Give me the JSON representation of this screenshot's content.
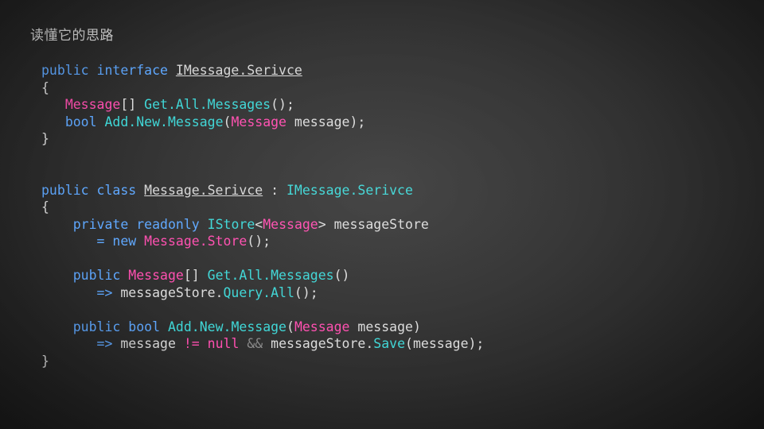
{
  "slide": {
    "title": "读懂它的思路",
    "background_color": "#2d2d2d",
    "code_lines": [
      {
        "id": "line-1",
        "tokens": [
          {
            "t": "public",
            "c": "kw"
          },
          {
            "t": " ",
            "c": "plain"
          },
          {
            "t": "interface",
            "c": "kw"
          },
          {
            "t": " ",
            "c": "plain"
          },
          {
            "t": "IMessage.Serivce",
            "c": "typeund"
          }
        ]
      },
      {
        "id": "line-2",
        "tokens": [
          {
            "t": "{",
            "c": "punct"
          }
        ]
      },
      {
        "id": "line-3",
        "tokens": [
          {
            "t": "   ",
            "c": "plain"
          },
          {
            "t": "Message",
            "c": "typepink"
          },
          {
            "t": "[] ",
            "c": "punct"
          },
          {
            "t": "Get.All.Messages",
            "c": "method"
          },
          {
            "t": "();",
            "c": "punct"
          }
        ]
      },
      {
        "id": "line-4",
        "tokens": [
          {
            "t": "   ",
            "c": "plain"
          },
          {
            "t": "bool",
            "c": "kw"
          },
          {
            "t": " ",
            "c": "plain"
          },
          {
            "t": "Add.New.Message",
            "c": "method"
          },
          {
            "t": "(",
            "c": "punct"
          },
          {
            "t": "Message",
            "c": "typepink"
          },
          {
            "t": " message);",
            "c": "punct"
          }
        ]
      },
      {
        "id": "line-5",
        "tokens": [
          {
            "t": "}",
            "c": "punct"
          }
        ]
      },
      {
        "id": "line-6",
        "tokens": []
      },
      {
        "id": "line-7",
        "tokens": []
      },
      {
        "id": "line-8",
        "tokens": [
          {
            "t": "public",
            "c": "kw"
          },
          {
            "t": " ",
            "c": "plain"
          },
          {
            "t": "class",
            "c": "kw"
          },
          {
            "t": " ",
            "c": "plain"
          },
          {
            "t": "Message.Serivce",
            "c": "typeund"
          },
          {
            "t": " : ",
            "c": "punct"
          },
          {
            "t": "IMessage.Serivce",
            "c": "type"
          }
        ]
      },
      {
        "id": "line-9",
        "tokens": [
          {
            "t": "{",
            "c": "punct"
          }
        ]
      },
      {
        "id": "line-10",
        "tokens": [
          {
            "t": "    ",
            "c": "plain"
          },
          {
            "t": "private",
            "c": "kw"
          },
          {
            "t": " ",
            "c": "plain"
          },
          {
            "t": "readonly",
            "c": "kw"
          },
          {
            "t": " ",
            "c": "plain"
          },
          {
            "t": "IStore",
            "c": "type"
          },
          {
            "t": "<",
            "c": "punct"
          },
          {
            "t": "Message",
            "c": "typepink"
          },
          {
            "t": "> messageStore",
            "c": "punct"
          }
        ]
      },
      {
        "id": "line-11",
        "tokens": [
          {
            "t": "       = ",
            "c": "op"
          },
          {
            "t": "new",
            "c": "kw"
          },
          {
            "t": " ",
            "c": "plain"
          },
          {
            "t": "Message.Store",
            "c": "typepink"
          },
          {
            "t": "();",
            "c": "punct"
          }
        ]
      },
      {
        "id": "line-12",
        "tokens": []
      },
      {
        "id": "line-13",
        "tokens": [
          {
            "t": "    ",
            "c": "plain"
          },
          {
            "t": "public",
            "c": "kw"
          },
          {
            "t": " ",
            "c": "plain"
          },
          {
            "t": "Message",
            "c": "typepink"
          },
          {
            "t": "[] ",
            "c": "punct"
          },
          {
            "t": "Get.All.Messages",
            "c": "method"
          },
          {
            "t": "()",
            "c": "punct"
          }
        ]
      },
      {
        "id": "line-14",
        "tokens": [
          {
            "t": "       ",
            "c": "plain"
          },
          {
            "t": "=>",
            "c": "op"
          },
          {
            "t": " messageStore.",
            "c": "punct"
          },
          {
            "t": "Query.All",
            "c": "method"
          },
          {
            "t": "();",
            "c": "punct"
          }
        ]
      },
      {
        "id": "line-15",
        "tokens": []
      },
      {
        "id": "line-16",
        "tokens": [
          {
            "t": "    ",
            "c": "plain"
          },
          {
            "t": "public",
            "c": "kw"
          },
          {
            "t": " ",
            "c": "plain"
          },
          {
            "t": "bool",
            "c": "kw"
          },
          {
            "t": " ",
            "c": "plain"
          },
          {
            "t": "Add.New.Message",
            "c": "method"
          },
          {
            "t": "(",
            "c": "punct"
          },
          {
            "t": "Message",
            "c": "typepink"
          },
          {
            "t": " message)",
            "c": "punct"
          }
        ]
      },
      {
        "id": "line-17",
        "tokens": [
          {
            "t": "       ",
            "c": "plain"
          },
          {
            "t": "=>",
            "c": "op"
          },
          {
            "t": " message ",
            "c": "punct"
          },
          {
            "t": "!=",
            "c": "nullkw"
          },
          {
            "t": " ",
            "c": "plain"
          },
          {
            "t": "null",
            "c": "nullkw"
          },
          {
            "t": " ",
            "c": "plain"
          },
          {
            "t": "&&",
            "c": "amp"
          },
          {
            "t": " messageStore.",
            "c": "punct"
          },
          {
            "t": "Save",
            "c": "method"
          },
          {
            "t": "(message);",
            "c": "punct"
          }
        ]
      },
      {
        "id": "line-18",
        "tokens": [
          {
            "t": "}",
            "c": "punct"
          }
        ]
      }
    ]
  }
}
